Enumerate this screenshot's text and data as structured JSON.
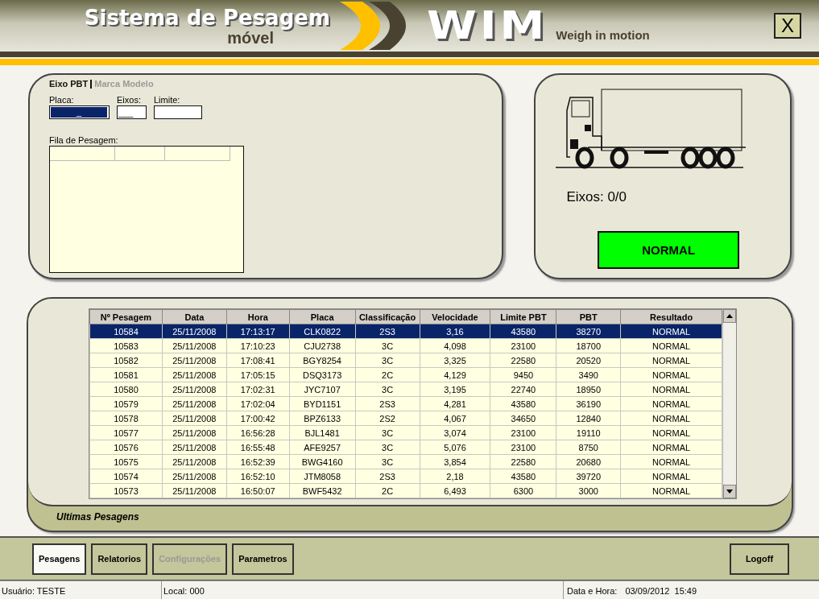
{
  "header": {
    "title": "Sistema de Pesagem",
    "subtitle": "móvel",
    "logo": "WIM",
    "tagline": "Weigh in motion",
    "close": "X"
  },
  "entry_panel": {
    "tabs": [
      {
        "label": "Eixo PBT",
        "selected": true
      },
      {
        "label": "Marca Modelo",
        "selected": false
      }
    ],
    "fields": [
      {
        "label": "Placa:",
        "value": "_",
        "highlighted": true
      },
      {
        "label": "Eixos:",
        "value": "___",
        "highlighted": false
      },
      {
        "label": "Limite:",
        "highlighted": false
      }
    ],
    "queue_label": "Fila de Pesagem:"
  },
  "vehicle_panel": {
    "axles": "Eixos:  0/0",
    "result": "NORMAL",
    "color": "#00ff00"
  },
  "table": {
    "columns": [
      "Nº Pesagem",
      "Data",
      "Hora",
      "Placa",
      "Classificação",
      "Velocidade",
      "Limite PBT",
      "PBT",
      "Resultado"
    ],
    "rows": [
      {
        "cells": [
          "10584",
          "25/11/2008",
          "17:13:17",
          "CLK0822",
          "2S3",
          "3,16",
          "43580",
          "38270",
          "NORMAL"
        ],
        "selected": true
      },
      {
        "cells": [
          "10583",
          "25/11/2008",
          "17:10:23",
          "CJU2738",
          "3C",
          "4,098",
          "23100",
          "18700",
          "NORMAL"
        ],
        "selected": false
      },
      {
        "cells": [
          "10582",
          "25/11/2008",
          "17:08:41",
          "BGY8254",
          "3C",
          "3,325",
          "22580",
          "20520",
          "NORMAL"
        ],
        "selected": false
      },
      {
        "cells": [
          "10581",
          "25/11/2008",
          "17:05:15",
          "DSQ3173",
          "2C",
          "4,129",
          "9450",
          "3490",
          "NORMAL"
        ],
        "selected": false
      },
      {
        "cells": [
          "10580",
          "25/11/2008",
          "17:02:31",
          "JYC7107",
          "3C",
          "3,195",
          "22740",
          "18950",
          "NORMAL"
        ],
        "selected": false
      },
      {
        "cells": [
          "10579",
          "25/11/2008",
          "17:02:04",
          "BYD1151",
          "2S3",
          "4,281",
          "43580",
          "36190",
          "NORMAL"
        ],
        "selected": false
      },
      {
        "cells": [
          "10578",
          "25/11/2008",
          "17:00:42",
          "BPZ6133",
          "2S2",
          "4,067",
          "34650",
          "12840",
          "NORMAL"
        ],
        "selected": false
      },
      {
        "cells": [
          "10577",
          "25/11/2008",
          "16:56:28",
          "BJL1481",
          "3C",
          "3,074",
          "23100",
          "19110",
          "NORMAL"
        ],
        "selected": false
      },
      {
        "cells": [
          "10576",
          "25/11/2008",
          "16:55:48",
          "AFE9257",
          "3C",
          "5,076",
          "23100",
          "8750",
          "NORMAL"
        ],
        "selected": false
      },
      {
        "cells": [
          "10575",
          "25/11/2008",
          "16:52:39",
          "BWG4160",
          "3C",
          "3,854",
          "22580",
          "20680",
          "NORMAL"
        ],
        "selected": false
      },
      {
        "cells": [
          "10574",
          "25/11/2008",
          "16:52:10",
          "JTM8058",
          "2S3",
          "2,18",
          "43580",
          "39720",
          "NORMAL"
        ],
        "selected": false
      },
      {
        "cells": [
          "10573",
          "25/11/2008",
          "16:50:07",
          "BWF5432",
          "2C",
          "6,493",
          "6300",
          "3000",
          "NORMAL"
        ],
        "selected": false
      }
    ],
    "caption": "Ultimas Pesagens"
  },
  "nav": [
    {
      "label": "Pesagens",
      "selected": true,
      "disabled": false
    },
    {
      "label": "Relatorios",
      "selected": false,
      "disabled": false
    },
    {
      "label": "Configurações",
      "selected": false,
      "disabled": true
    },
    {
      "label": "Parametros",
      "selected": false,
      "disabled": false
    }
  ],
  "logoff": "Logoff",
  "status_bar": {
    "user": "Usuário: TESTE",
    "local": "Local: 000",
    "datetime_label": "Data e Hora:",
    "datetime": "03/09/2012  15:49"
  }
}
